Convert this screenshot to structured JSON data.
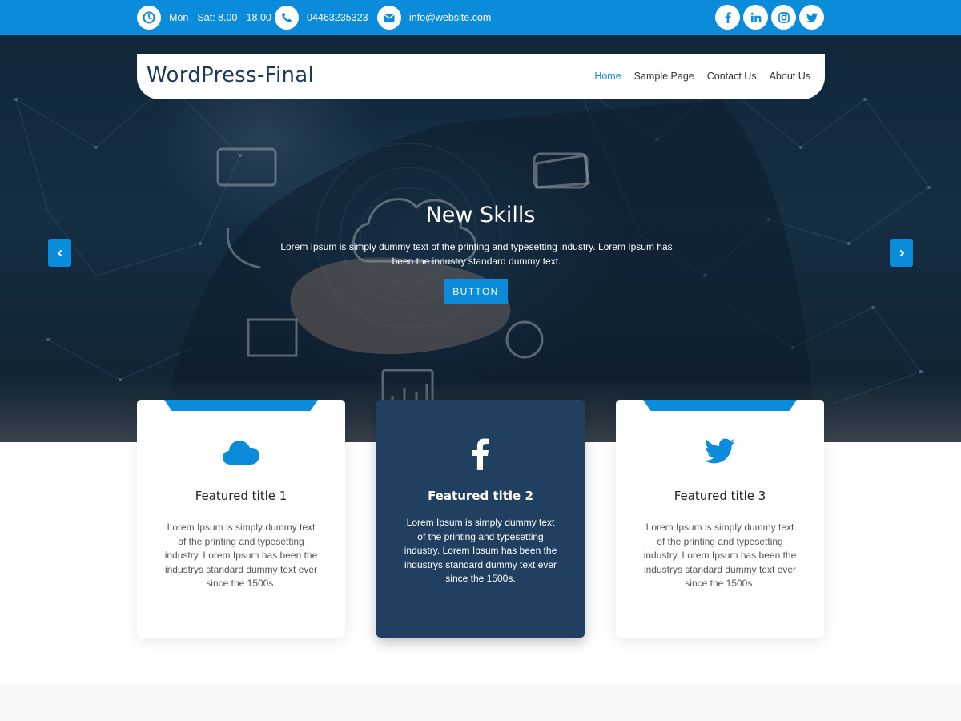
{
  "topbar": {
    "hours": "Mon - Sat: 8.00 - 18.00",
    "phone": "04463235323",
    "email": "info@website.com",
    "social_icons": [
      "facebook-icon",
      "linkedin-icon",
      "instagram-icon",
      "twitter-icon"
    ]
  },
  "header": {
    "site_title": "WordPress-Final",
    "nav": [
      {
        "label": "Home",
        "active": true
      },
      {
        "label": "Sample Page",
        "active": false
      },
      {
        "label": "Contact Us",
        "active": false
      },
      {
        "label": "About Us",
        "active": false
      }
    ]
  },
  "hero": {
    "title": "New Skills",
    "text": "Lorem Ipsum is simply dummy text of the printing and typesetting industry. Lorem Ipsum has been the industry standard dummy text.",
    "button": "BUTTON",
    "prev_icon": "chevron-left-icon",
    "next_icon": "chevron-right-icon"
  },
  "features": [
    {
      "icon": "cloud-icon",
      "title": "Featured title 1",
      "text": "Lorem Ipsum is simply dummy text of the printing and typesetting industry. Lorem Ipsum has been the industrys standard dummy text ever since the 1500s."
    },
    {
      "icon": "facebook-icon",
      "title": "Featured title 2",
      "text": "Lorem Ipsum is simply dummy text of the printing and typesetting industry. Lorem Ipsum has been the industrys standard dummy text ever since the 1500s."
    },
    {
      "icon": "twitter-icon",
      "title": "Featured title 3",
      "text": "Lorem Ipsum is simply dummy text of the printing and typesetting industry. Lorem Ipsum has been the industrys standard dummy text ever since the 1500s."
    }
  ],
  "colors": {
    "accent": "#0a8cdb",
    "dark_card": "#213f60",
    "site_title": "#1e3a5a"
  }
}
